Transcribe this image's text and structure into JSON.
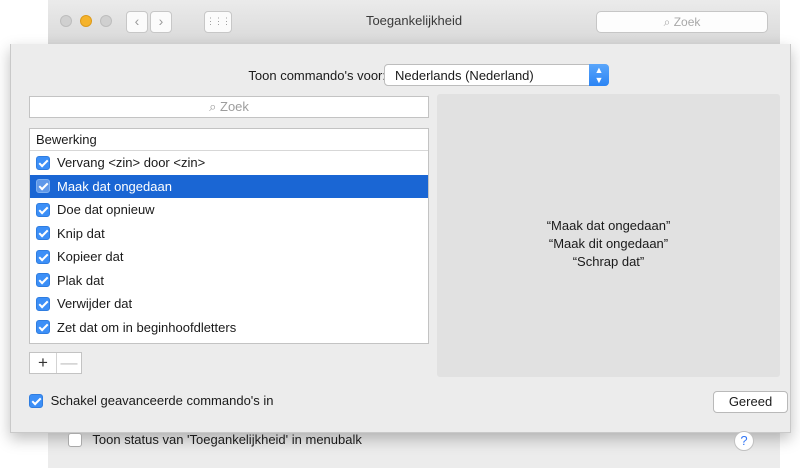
{
  "window": {
    "title": "Toegankelijkheid",
    "search_placeholder": "Zoek",
    "nav_back": "‹",
    "nav_forward": "›",
    "grid": "⋮⋮⋮"
  },
  "sheet": {
    "show_commands_label": "Toon commando's voor:",
    "language_select": "Nederlands (Nederland)",
    "list_search_placeholder": "Zoek",
    "list_header": "Bewerking",
    "commands": [
      {
        "label": "Vervang <zin> door <zin>",
        "checked": true,
        "selected": false
      },
      {
        "label": "Maak dat ongedaan",
        "checked": true,
        "selected": true
      },
      {
        "label": "Doe dat opnieuw",
        "checked": true,
        "selected": false
      },
      {
        "label": "Knip dat",
        "checked": true,
        "selected": false
      },
      {
        "label": "Kopieer dat",
        "checked": true,
        "selected": false
      },
      {
        "label": "Plak dat",
        "checked": true,
        "selected": false
      },
      {
        "label": "Verwijder dat",
        "checked": true,
        "selected": false
      },
      {
        "label": "Zet dat om in beginhoofdletters",
        "checked": true,
        "selected": false
      }
    ],
    "add_label": "+",
    "remove_label": "—",
    "detail_lines": [
      "“Maak dat ongedaan”",
      "“Maak dit ongedaan”",
      "“Schrap dat”"
    ],
    "advanced_label": "Schakel geavanceerde commando's in",
    "advanced_checked": true,
    "done_label": "Gereed"
  },
  "footer": {
    "status_label": "Toon status van 'Toegankelijkheid' in menubalk",
    "status_checked": false,
    "help_label": "?"
  },
  "colors": {
    "accent": "#3c8ff7",
    "selection": "#1a66d4"
  }
}
